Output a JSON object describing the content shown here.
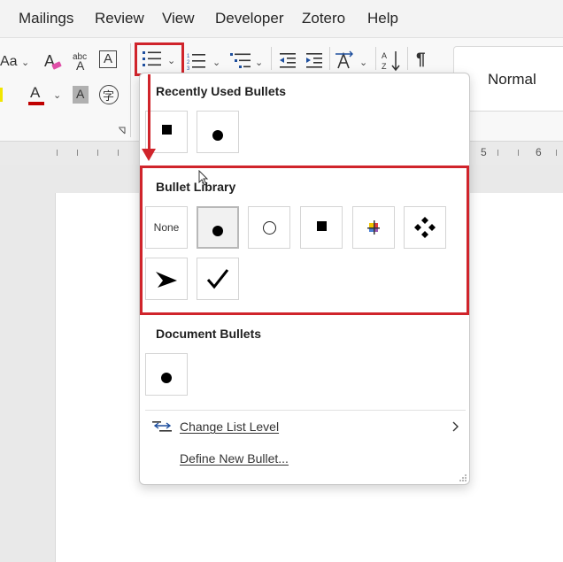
{
  "menubar": {
    "items": [
      "Mailings",
      "Review",
      "View",
      "Developer",
      "Zotero",
      "Help"
    ]
  },
  "ribbon": {
    "font_size_label": "Aa",
    "clear_format_label": "A",
    "text_effects_label": "A",
    "font_color_label": "A",
    "char_shading_label": "A",
    "phonetic_label": "字",
    "style_normal": "Normal"
  },
  "ruler": {
    "numbers": [
      "5",
      "6"
    ]
  },
  "dropdown": {
    "recently_used_title": "Recently Used Bullets",
    "bullet_library_title": "Bullet Library",
    "document_bullets_title": "Document Bullets",
    "none_label": "None",
    "change_list_level_label": "Change List Level",
    "define_new_bullet_label": "Define New Bullet..."
  },
  "colors": {
    "highlight_red": "#d0242b",
    "font_color_underline": "#c00000"
  }
}
